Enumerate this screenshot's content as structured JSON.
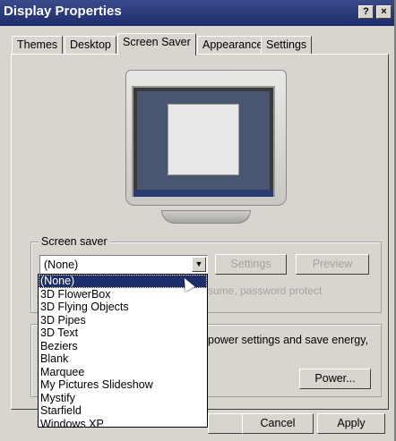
{
  "window": {
    "title": "Display Properties",
    "help_button": "?",
    "close_button": "×"
  },
  "tabs": [
    {
      "label": "Themes"
    },
    {
      "label": "Desktop"
    },
    {
      "label": "Screen Saver"
    },
    {
      "label": "Appearance"
    },
    {
      "label": "Settings"
    }
  ],
  "screen_saver": {
    "group_label": "Screen saver",
    "selected": "(None)",
    "settings_button": "Settings",
    "preview_button": "Preview",
    "resume_text": "sume, password protect",
    "options": [
      "(None)",
      "3D FlowerBox",
      "3D Flying Objects",
      "3D Pipes",
      "3D Text",
      "Beziers",
      "Blank",
      "Marquee",
      "My Pictures Slideshow",
      "Mystify",
      "Starfield",
      "Windows XP"
    ]
  },
  "power": {
    "text": "power settings and save energy,",
    "power_button": "Power..."
  },
  "footer": {
    "cancel_button": "Cancel",
    "apply_button": "Apply"
  }
}
